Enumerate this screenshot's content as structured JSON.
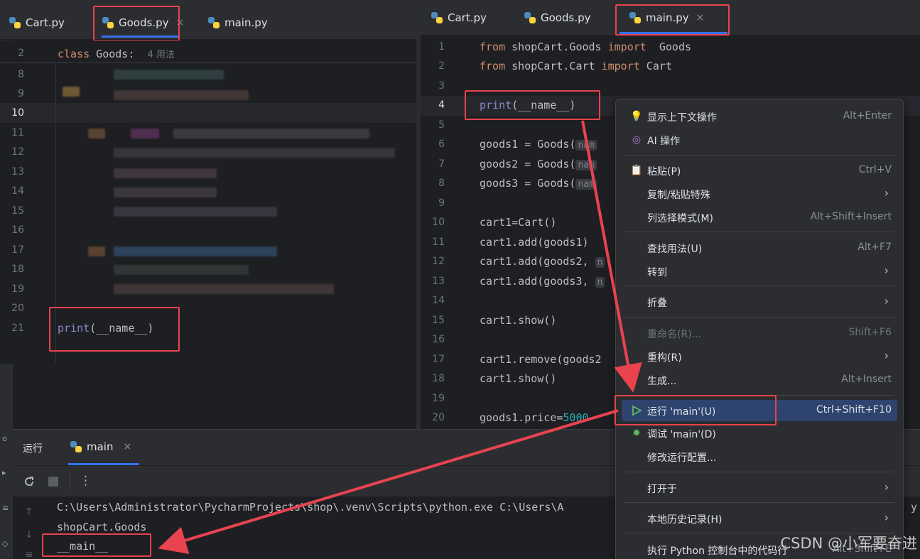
{
  "left_tabs": [
    {
      "label": "Cart.py"
    },
    {
      "label": "Goods.py",
      "close": "×"
    },
    {
      "label": "main.py"
    }
  ],
  "right_tabs": [
    {
      "label": "Cart.py"
    },
    {
      "label": "Goods.py"
    },
    {
      "label": "main.py",
      "close": "×"
    }
  ],
  "left_editor": {
    "line_numbers": [
      "2",
      "8",
      "9",
      "10",
      "11",
      "12",
      "13",
      "14",
      "15",
      "16",
      "17",
      "18",
      "19",
      "20",
      "21"
    ],
    "class_line": {
      "kw": "class",
      "name": " Goods:",
      "hint": "4 用法"
    },
    "print_line": {
      "fn": "print",
      "rest": "(__name__)"
    }
  },
  "right_editor": {
    "line_numbers": [
      "1",
      "2",
      "3",
      "4",
      "5",
      "6",
      "7",
      "8",
      "9",
      "10",
      "11",
      "12",
      "13",
      "14",
      "15",
      "16",
      "17",
      "18",
      "19",
      "20"
    ],
    "lines": {
      "l1": {
        "a": "from",
        "b": " shopCart.Goods ",
        "c": "import",
        "d": "  Goods"
      },
      "l2": {
        "a": "from",
        "b": " shopCart.Cart ",
        "c": "import",
        "d": " Cart"
      },
      "l4": {
        "fn": "print",
        "rest": "(__name__)"
      },
      "l6": "goods1 = Goods(",
      "l7": "goods2 = Goods(",
      "l8": "goods3 = Goods(",
      "hint_name": "nam",
      "l10": "cart1=Cart()",
      "l11": "cart1.add(goods1)",
      "l12": "cart1.add(goods2, ",
      "l13": "cart1.add(goods3, ",
      "hint_n": "n",
      "l15": "cart1.show()",
      "l17": "cart1.remove(goods2",
      "l18": "cart1.show()",
      "l20a": "goods1.price=",
      "l20b": "5000"
    }
  },
  "run_panel": {
    "title": "运行",
    "tab_label": "main",
    "tab_close": "×",
    "more": "⋮",
    "console": [
      "C:\\Users\\Administrator\\PycharmProjects\\shop\\.venv\\Scripts\\python.exe C:\\Users\\A",
      "shopCart.Goods",
      "__main__"
    ],
    "console_tail": "y"
  },
  "context_menu": {
    "items": [
      {
        "label": "显示上下文操作",
        "shortcut": "Alt+Enter",
        "icon": "lightbulb-icon"
      },
      {
        "label": "AI 操作",
        "shortcut": "",
        "icon": "ai-spiral-icon"
      },
      {
        "label": "粘贴(P)",
        "shortcut": "Ctrl+V",
        "icon": "clipboard-icon"
      },
      {
        "label": "复制/粘贴特殊",
        "shortcut": "",
        "submenu": "›"
      },
      {
        "label": "列选择模式(M)",
        "shortcut": "Alt+Shift+Insert"
      },
      {
        "label": "查找用法(U)",
        "shortcut": "Alt+F7"
      },
      {
        "label": "转到",
        "shortcut": "",
        "submenu": "›"
      },
      {
        "label": "折叠",
        "shortcut": "",
        "submenu": "›"
      },
      {
        "label": "重命名(R)...",
        "shortcut": "Shift+F6",
        "disabled": true
      },
      {
        "label": "重构(R)",
        "shortcut": "",
        "submenu": "›"
      },
      {
        "label": "生成...",
        "shortcut": "Alt+Insert"
      },
      {
        "label": "运行 'main'(U)",
        "shortcut": "Ctrl+Shift+F10",
        "icon": "run-triangle-icon",
        "selected": true
      },
      {
        "label": "调试 'main'(D)",
        "shortcut": "",
        "icon": "debug-bug-icon"
      },
      {
        "label": "修改运行配置...",
        "shortcut": ""
      },
      {
        "label": "打开于",
        "shortcut": "",
        "submenu": "›"
      },
      {
        "label": "本地历史记录(H)",
        "shortcut": "",
        "submenu": "›"
      },
      {
        "label": "执行 Python 控制台中的代码行",
        "shortcut": "Alt+Shift+E"
      }
    ]
  },
  "watermark": "CSDN @小军要奋进",
  "colors": {
    "highlight_red": "#e8434f",
    "selection_blue": "#2e436e"
  }
}
